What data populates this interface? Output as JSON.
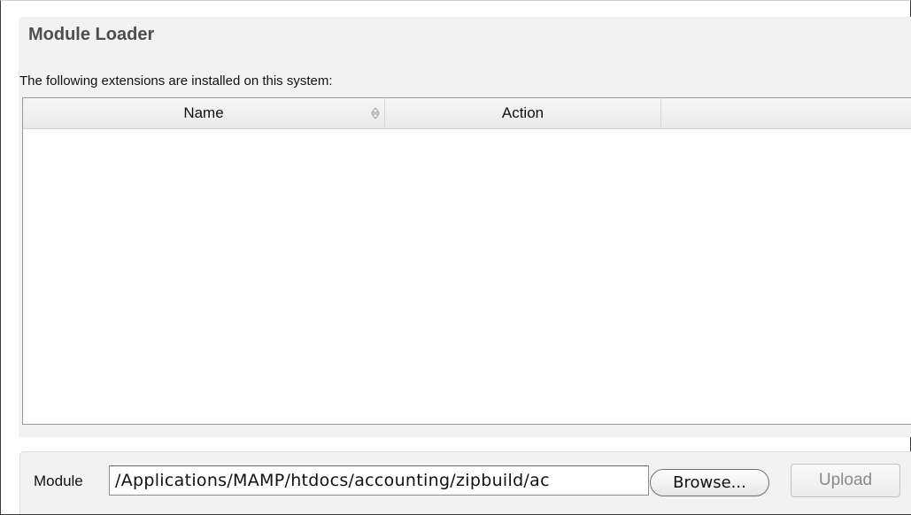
{
  "header": {
    "title": "Module Loader"
  },
  "intro": {
    "text": "The following extensions are installed on this system:"
  },
  "extensions_table": {
    "columns": [
      "Name",
      "Action",
      ""
    ],
    "sort_column": "Name",
    "rows": []
  },
  "upload_form": {
    "module_label": "Module",
    "file_path_value": "/Applications/MAMP/htdocs/accounting/zipbuild/ac",
    "browse_label": "Browse...",
    "upload_label": "Upload",
    "upload_enabled": false
  },
  "icons": {
    "sort": "sort-arrows-icon"
  },
  "colors": {
    "background": "#f2f2f2",
    "title": "#4e4e4e",
    "table_border": "#9a9a9a",
    "disabled_text": "#8a8a8a"
  }
}
